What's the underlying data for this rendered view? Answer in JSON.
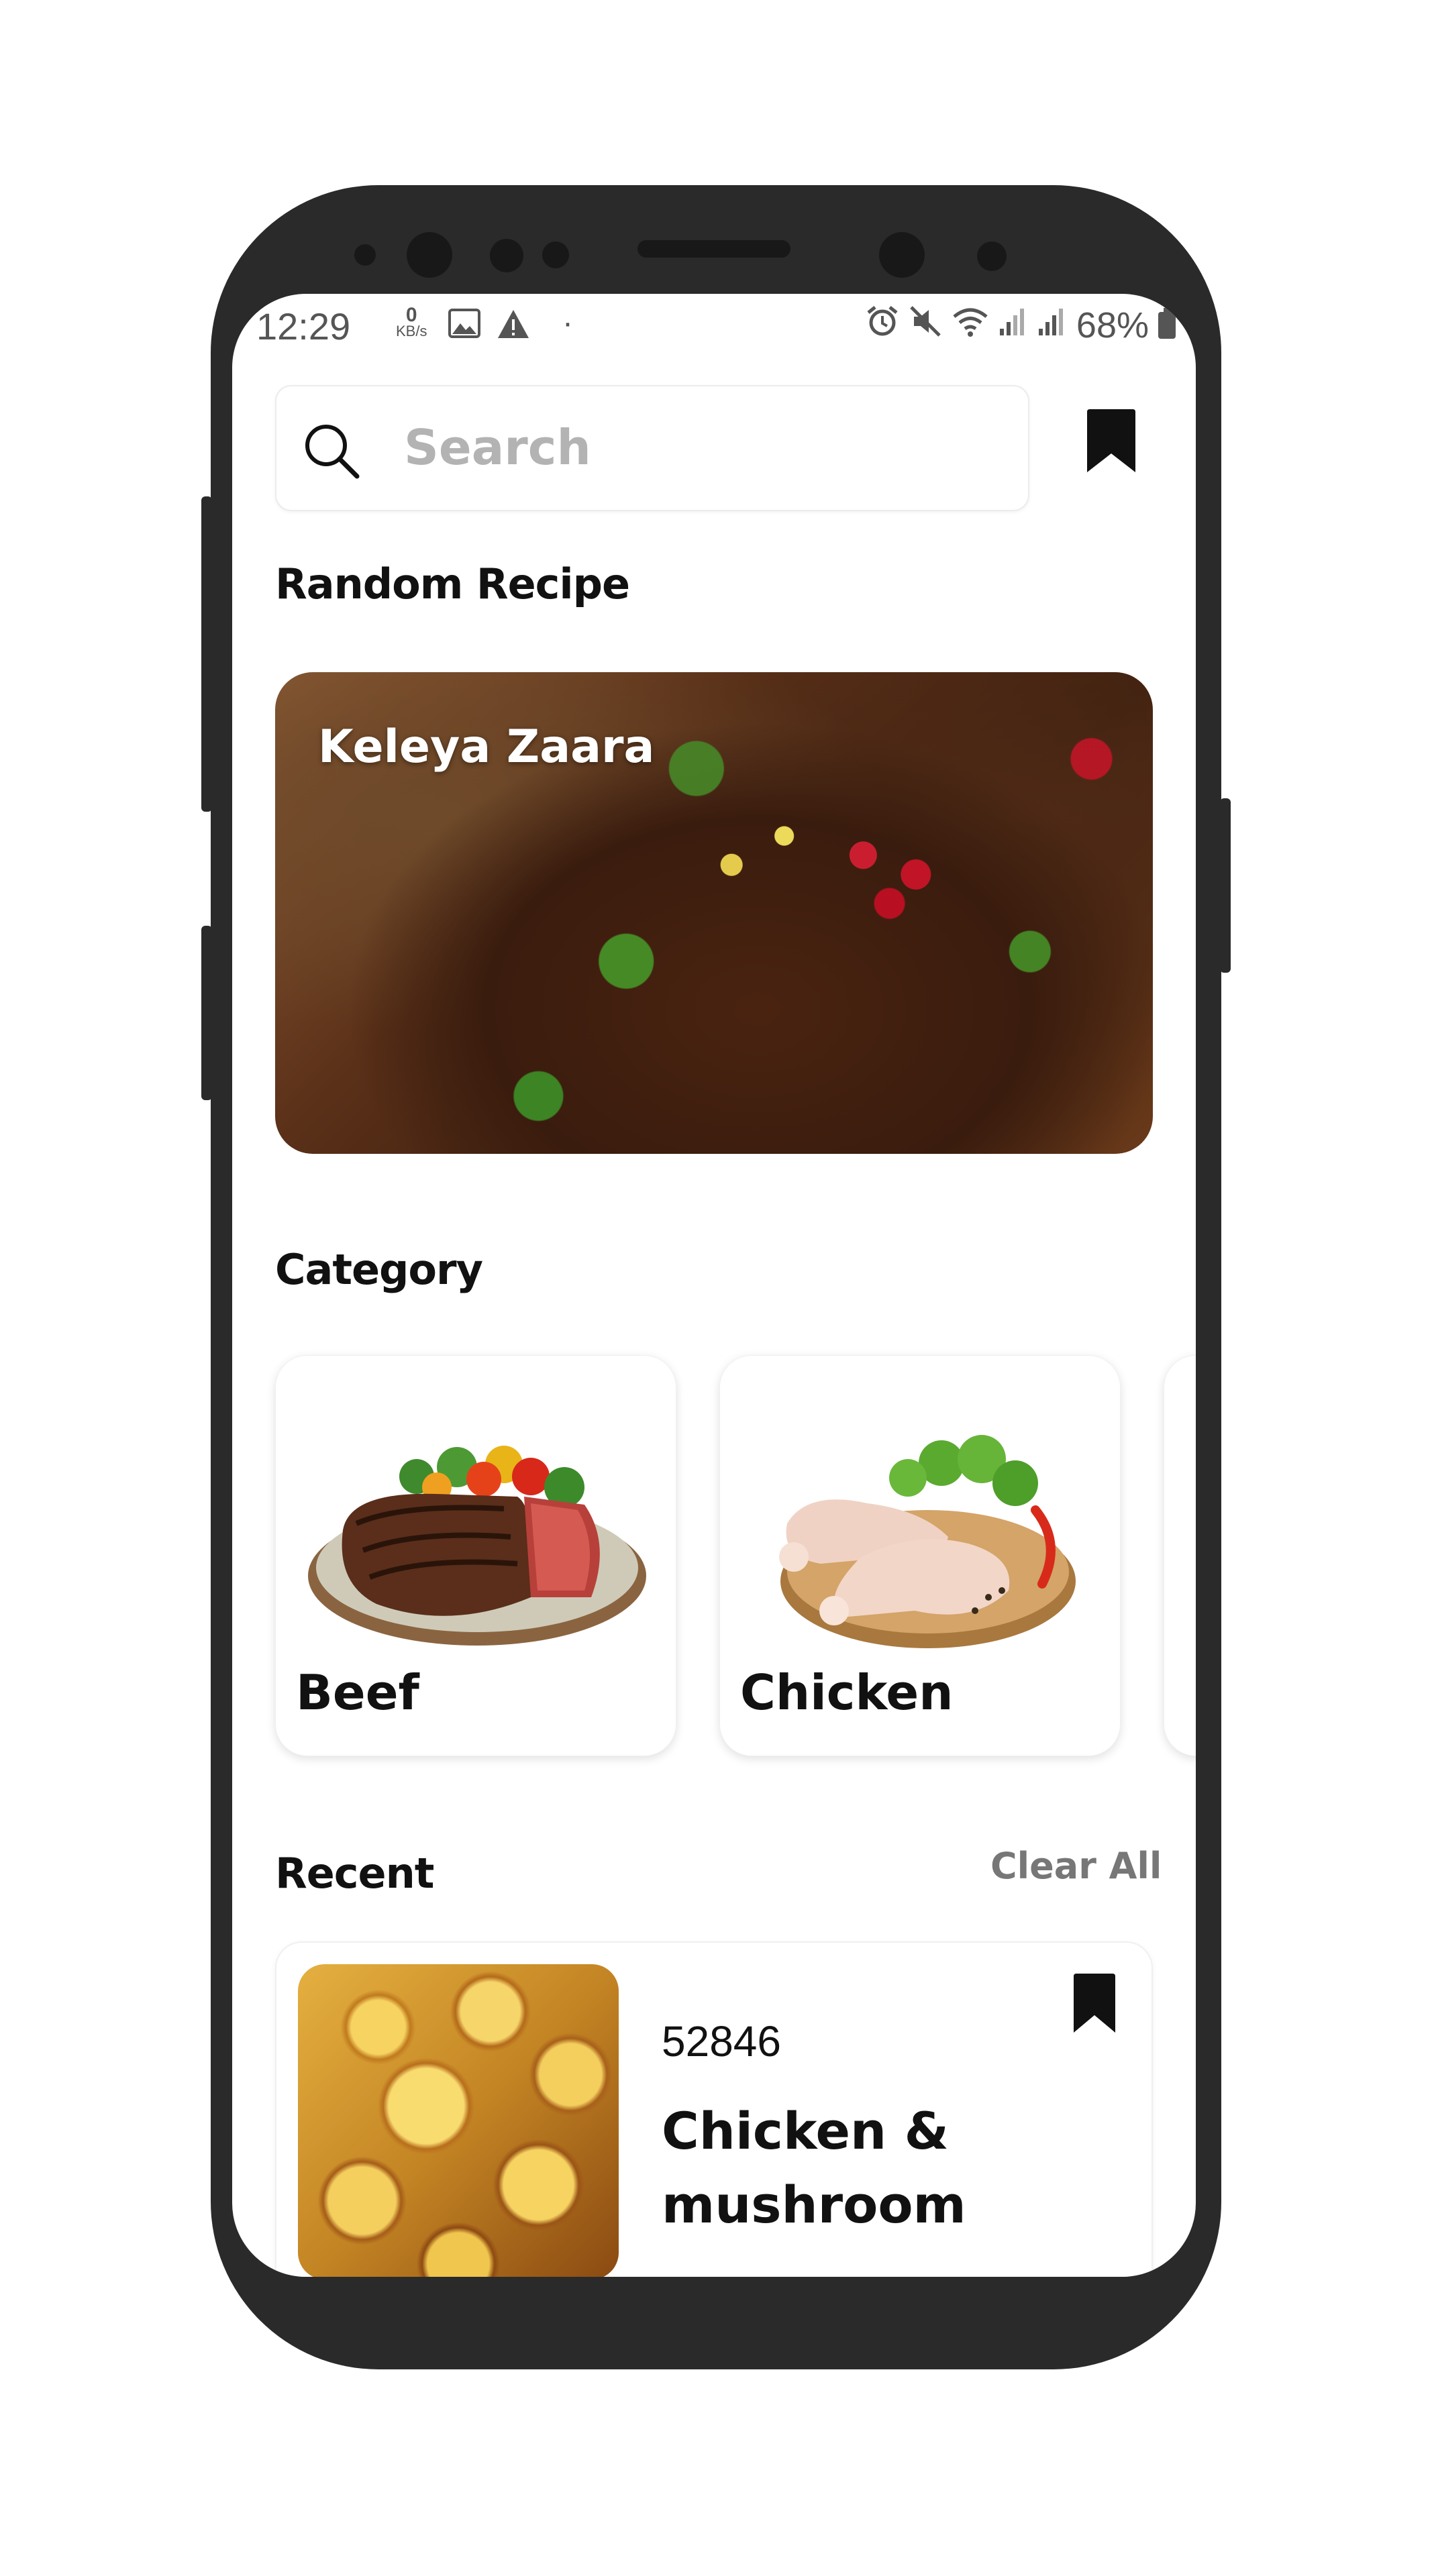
{
  "status_bar": {
    "time": "12:29",
    "data_rate_value": "0",
    "data_rate_unit": "KB/s",
    "dot": "·",
    "battery": "68%"
  },
  "search": {
    "placeholder": "Search"
  },
  "random_recipe": {
    "section_title": "Random Recipe",
    "name": "Keleya Zaara"
  },
  "category": {
    "section_title": "Category",
    "items": [
      {
        "label": "Beef"
      },
      {
        "label": "Chicken"
      }
    ]
  },
  "recent": {
    "section_title": "Recent",
    "clear_all_label": "Clear All",
    "items": [
      {
        "id": "52846",
        "title": "Chicken & mushroom"
      }
    ]
  },
  "colors": {
    "phone_frame": "#2a2a2a",
    "text_primary": "#111111",
    "text_secondary": "#777777",
    "placeholder": "#b3b3b3"
  }
}
